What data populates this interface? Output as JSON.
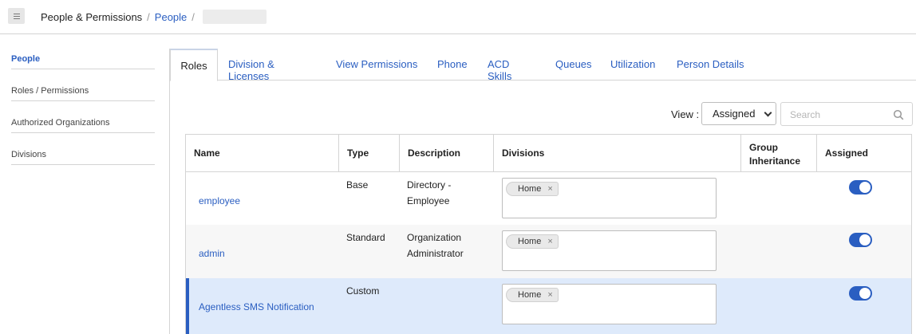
{
  "breadcrumb": {
    "root": "People & Permissions",
    "sep": "/",
    "people": "People"
  },
  "sidebar": {
    "items": [
      {
        "label": "People",
        "active": true
      },
      {
        "label": "Roles / Permissions"
      },
      {
        "label": "Authorized Organizations"
      },
      {
        "label": "Divisions"
      }
    ]
  },
  "tabs": [
    {
      "label": "Roles",
      "active": true
    },
    {
      "label": "Division & Licenses"
    },
    {
      "label": "View Permissions"
    },
    {
      "label": "Phone"
    },
    {
      "label": "ACD Skills"
    },
    {
      "label": "Queues"
    },
    {
      "label": "Utilization"
    },
    {
      "label": "Person Details"
    }
  ],
  "filter": {
    "view_label": "View :",
    "view_value": "Assigned",
    "search_placeholder": "Search"
  },
  "table": {
    "headers": {
      "name": "Name",
      "type": "Type",
      "description": "Description",
      "divisions": "Divisions",
      "group_inheritance_1": "Group",
      "group_inheritance_2": "Inheritance",
      "assigned": "Assigned"
    },
    "rows": [
      {
        "name": "employee",
        "type": "Base",
        "desc_1": "Directory -",
        "desc_2": "Employee",
        "division": "Home",
        "chip_remove": "×",
        "assigned": true
      },
      {
        "name": "admin",
        "type": "Standard",
        "desc_1": "Organization",
        "desc_2": "Administrator",
        "division": "Home",
        "chip_remove": "×",
        "assigned": true
      },
      {
        "name": "Agentless SMS Notification",
        "type": "Custom",
        "desc_1": "",
        "desc_2": "",
        "division": "Home",
        "chip_remove": "×",
        "assigned": true
      }
    ]
  },
  "colors": {
    "accent": "#2a5ec1",
    "selected_row": "#deeafb"
  }
}
